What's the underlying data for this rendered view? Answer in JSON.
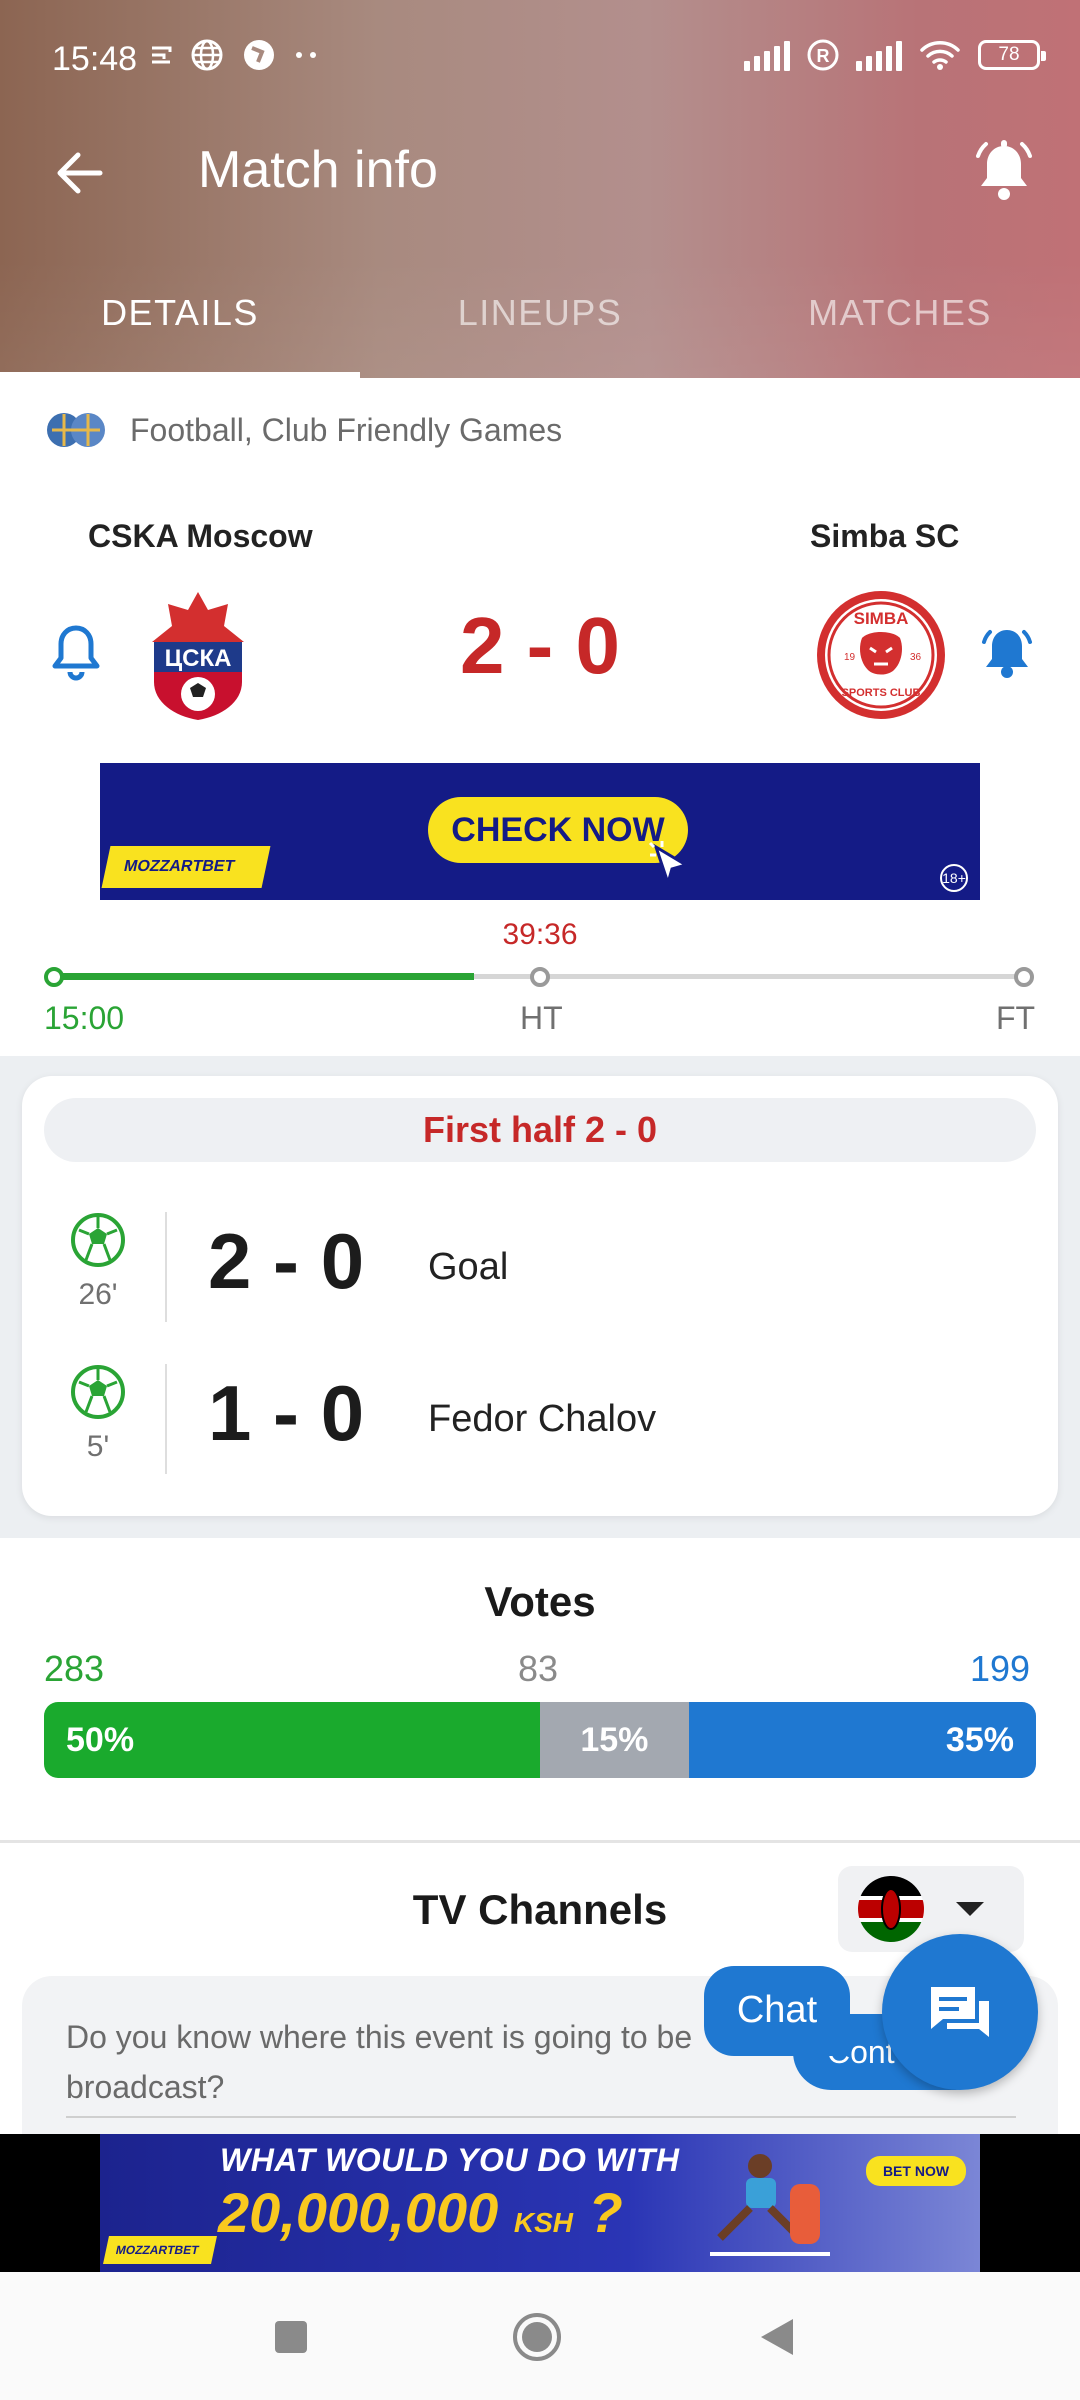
{
  "status": {
    "time": "15:48",
    "battery": "78"
  },
  "header": {
    "title": "Match info"
  },
  "tabs": [
    {
      "label": "DETAILS",
      "active": true
    },
    {
      "label": "LINEUPS",
      "active": false
    },
    {
      "label": "MATCHES",
      "active": false
    }
  ],
  "match": {
    "competition": "Football, Club Friendly Games",
    "home_team": "CSKA Moscow",
    "away_team": "Simba SC",
    "score": "2 - 0",
    "clock": "39:36",
    "timeline": {
      "start": "15:00",
      "half": "HT",
      "end": "FT",
      "progress": 0.43
    }
  },
  "ad_top": {
    "cta": "CHECK NOW",
    "brand": "MOZZARTBET",
    "age": "18+"
  },
  "events": {
    "half_label": "First half 2 - 0",
    "items": [
      {
        "minute": "26'",
        "score": "2 - 0",
        "desc": "Goal"
      },
      {
        "minute": "5'",
        "score": "1 - 0",
        "desc": "Fedor Chalov"
      }
    ]
  },
  "votes": {
    "title": "Votes",
    "home_count": "283",
    "draw_count": "83",
    "away_count": "199",
    "home_pct": "50%",
    "draw_pct": "15%",
    "away_pct": "35%",
    "colors": {
      "home": "#1aaa2d",
      "draw": "#a3a8b0",
      "away": "#1f78d1"
    }
  },
  "tv": {
    "title": "TV Channels",
    "question": "Do you know where this event is going to be broadcast?",
    "contribute": "Cont",
    "chat_label": "Chat"
  },
  "ad_bottom": {
    "line1": "WHAT WOULD YOU DO WITH",
    "line2": "20,000,000",
    "currency": "KSH",
    "qmark": "?",
    "brand": "MOZZARTBET",
    "betnow": "BET NOW"
  },
  "colors": {
    "accent": "#c62828",
    "green": "#2aa435",
    "blue": "#1f78d1"
  }
}
